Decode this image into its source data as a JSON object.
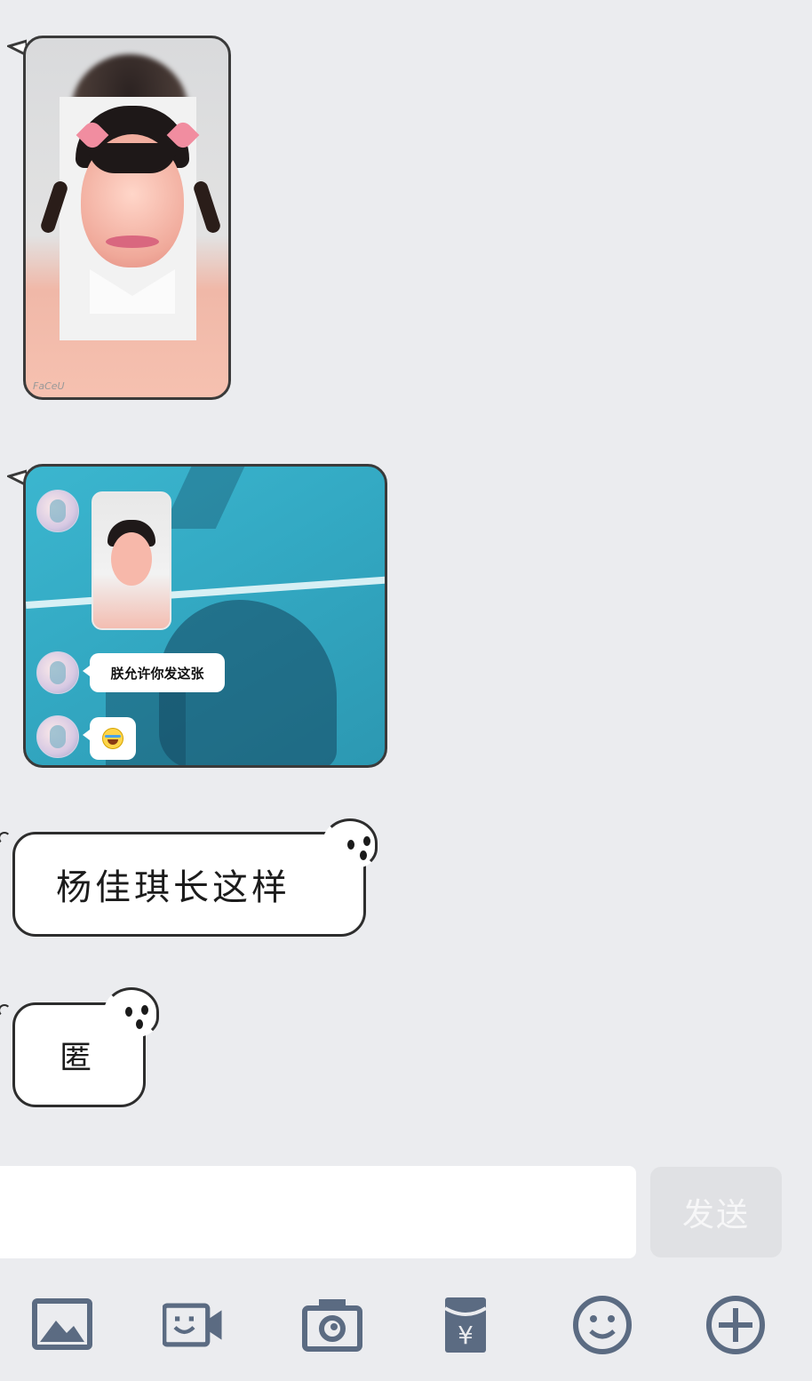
{
  "messages": [
    {
      "type": "image",
      "description": "selfie-photo",
      "watermark": "FaCeU"
    },
    {
      "type": "image",
      "description": "chat-screenshot",
      "embedded": {
        "bubble_text": "朕允许你发这张",
        "emoji": "tears-of-joy-emoji"
      }
    },
    {
      "type": "text",
      "text": "杨佳琪长这样"
    },
    {
      "type": "text",
      "text": "匿"
    }
  ],
  "input": {
    "value": "",
    "placeholder": ""
  },
  "send_button": {
    "label": "发送"
  },
  "toolbar": [
    {
      "icon": "image-icon"
    },
    {
      "icon": "video-icon"
    },
    {
      "icon": "camera-icon"
    },
    {
      "icon": "red-envelope-icon"
    },
    {
      "icon": "emoji-icon"
    },
    {
      "icon": "plus-icon"
    }
  ],
  "colors": {
    "background": "#ebecef",
    "send_disabled": "#e0e1e4",
    "toolbar_icon": "#5b6b82"
  }
}
